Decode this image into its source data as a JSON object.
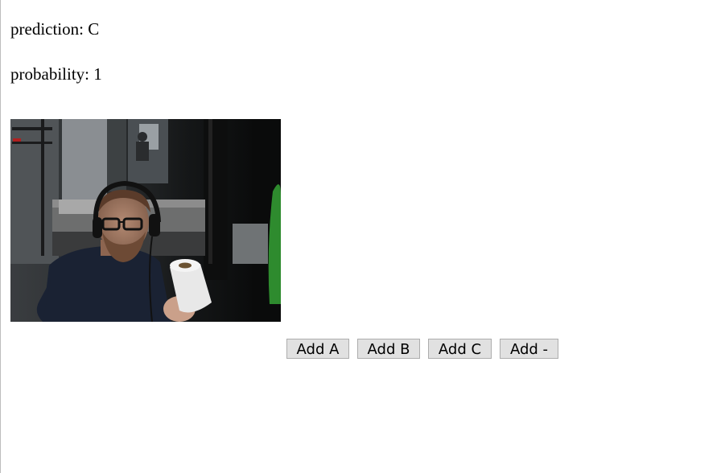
{
  "prediction": {
    "label": "prediction:",
    "value": "C"
  },
  "probability": {
    "label": "probability:",
    "value": "1"
  },
  "webcam": {
    "icon": "webcam-video-feed"
  },
  "buttons": {
    "add_a": "Add A",
    "add_b": "Add B",
    "add_c": "Add C",
    "add_minus": "Add -"
  }
}
